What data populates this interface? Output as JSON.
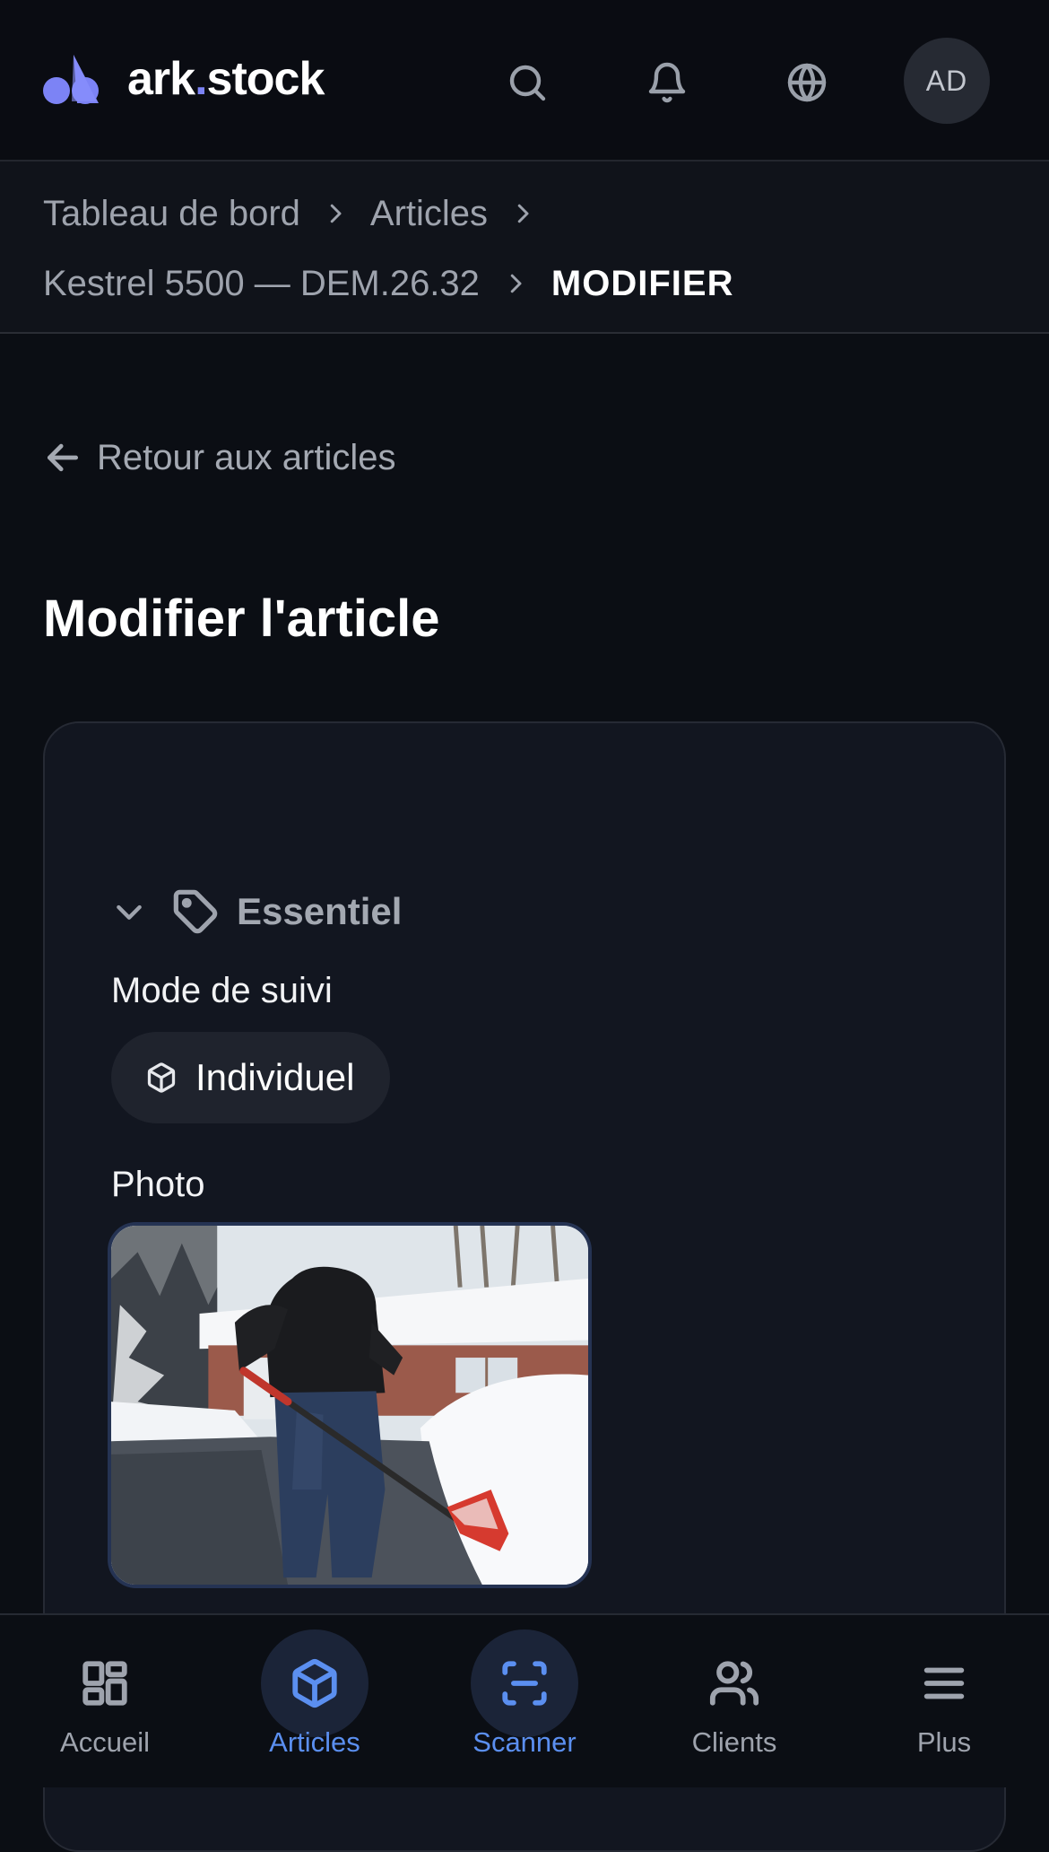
{
  "app": {
    "brand_prefix": "ark",
    "brand_dot": ".",
    "brand_suffix": "stock",
    "accent_color": "#7c83f5",
    "active_color": "#5b8ff0"
  },
  "header": {
    "icons": [
      "search-icon",
      "bell-icon",
      "globe-icon"
    ],
    "avatar_initials": "AD"
  },
  "breadcrumb": {
    "items": [
      "Tableau de bord",
      "Articles",
      "Kestrel 5500 — DEM.26.32"
    ],
    "current": "MODIFIER"
  },
  "back_link": {
    "label": "Retour aux articles"
  },
  "page": {
    "title": "Modifier l'article"
  },
  "form": {
    "section": {
      "title": "Essentiel",
      "icon": "tag-icon",
      "expanded": true
    },
    "tracking_mode": {
      "label": "Mode de suivi",
      "value": "Individuel",
      "icon": "box-icon"
    },
    "photo": {
      "label": "Photo"
    }
  },
  "bottom_nav": {
    "items": [
      {
        "label": "Accueil",
        "icon": "dashboard-icon",
        "active": false
      },
      {
        "label": "Articles",
        "icon": "package-icon",
        "active": true
      },
      {
        "label": "Scanner",
        "icon": "scan-icon",
        "active": true
      },
      {
        "label": "Clients",
        "icon": "users-icon",
        "active": false
      },
      {
        "label": "Plus",
        "icon": "menu-icon",
        "active": false
      }
    ]
  }
}
